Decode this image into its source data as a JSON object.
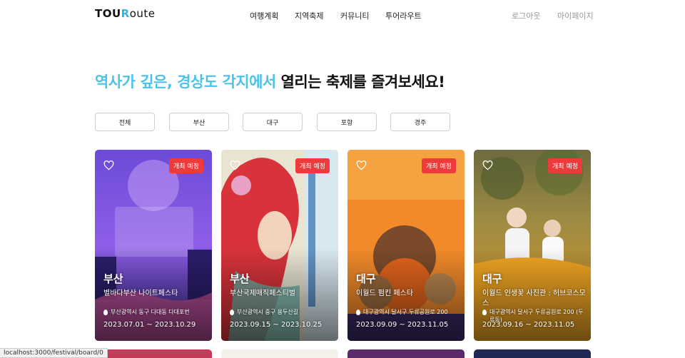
{
  "header": {
    "logo": {
      "part1": "TOU",
      "part2": "R",
      "part3": "oute"
    },
    "nav": [
      "여행계획",
      "지역축제",
      "커뮤니티",
      "투어라우트"
    ],
    "auth": {
      "logout": "로그아웃",
      "mypage": "마이페이지"
    }
  },
  "headline": {
    "highlight": "역사가 깊은, 경상도 각지에서",
    "rest": " 열리는 축제를 즐겨보세요!"
  },
  "filters": [
    "전체",
    "부산",
    "대구",
    "포항",
    "경주"
  ],
  "cards": [
    {
      "badge": "개최 예정",
      "region": "부산",
      "title": "별바다부산 나이트페스타",
      "address": "부산광역시 동구 다대동 다대포번",
      "date": "2023.07.01 ~ 2023.10.29"
    },
    {
      "badge": "개최 예정",
      "region": "부산",
      "title": "부산국제매직페스티벌",
      "address": "부산광역시 중구 용두산길",
      "date": "2023.09.15 ~ 2023.10.25"
    },
    {
      "badge": "개최 예정",
      "region": "대구",
      "title": "이월드 펌킨 페스타",
      "address": "대구광역시 달서구 두류공원로 200",
      "date": "2023.09.09 ~ 2023.11.05"
    },
    {
      "badge": "개최 예정",
      "region": "대구",
      "title": "이월드 인생꽃 사진관 : 허브코스모스",
      "address": "대구광역시 달서구 두류공원로 200 (두류동)",
      "date": "2023.09.16 ~ 2023.11.05"
    }
  ],
  "status_bar": "localhost:3000/festival/board/0",
  "colors": {
    "accent": "#4cc2e6",
    "badge": "#ee3a3a"
  }
}
